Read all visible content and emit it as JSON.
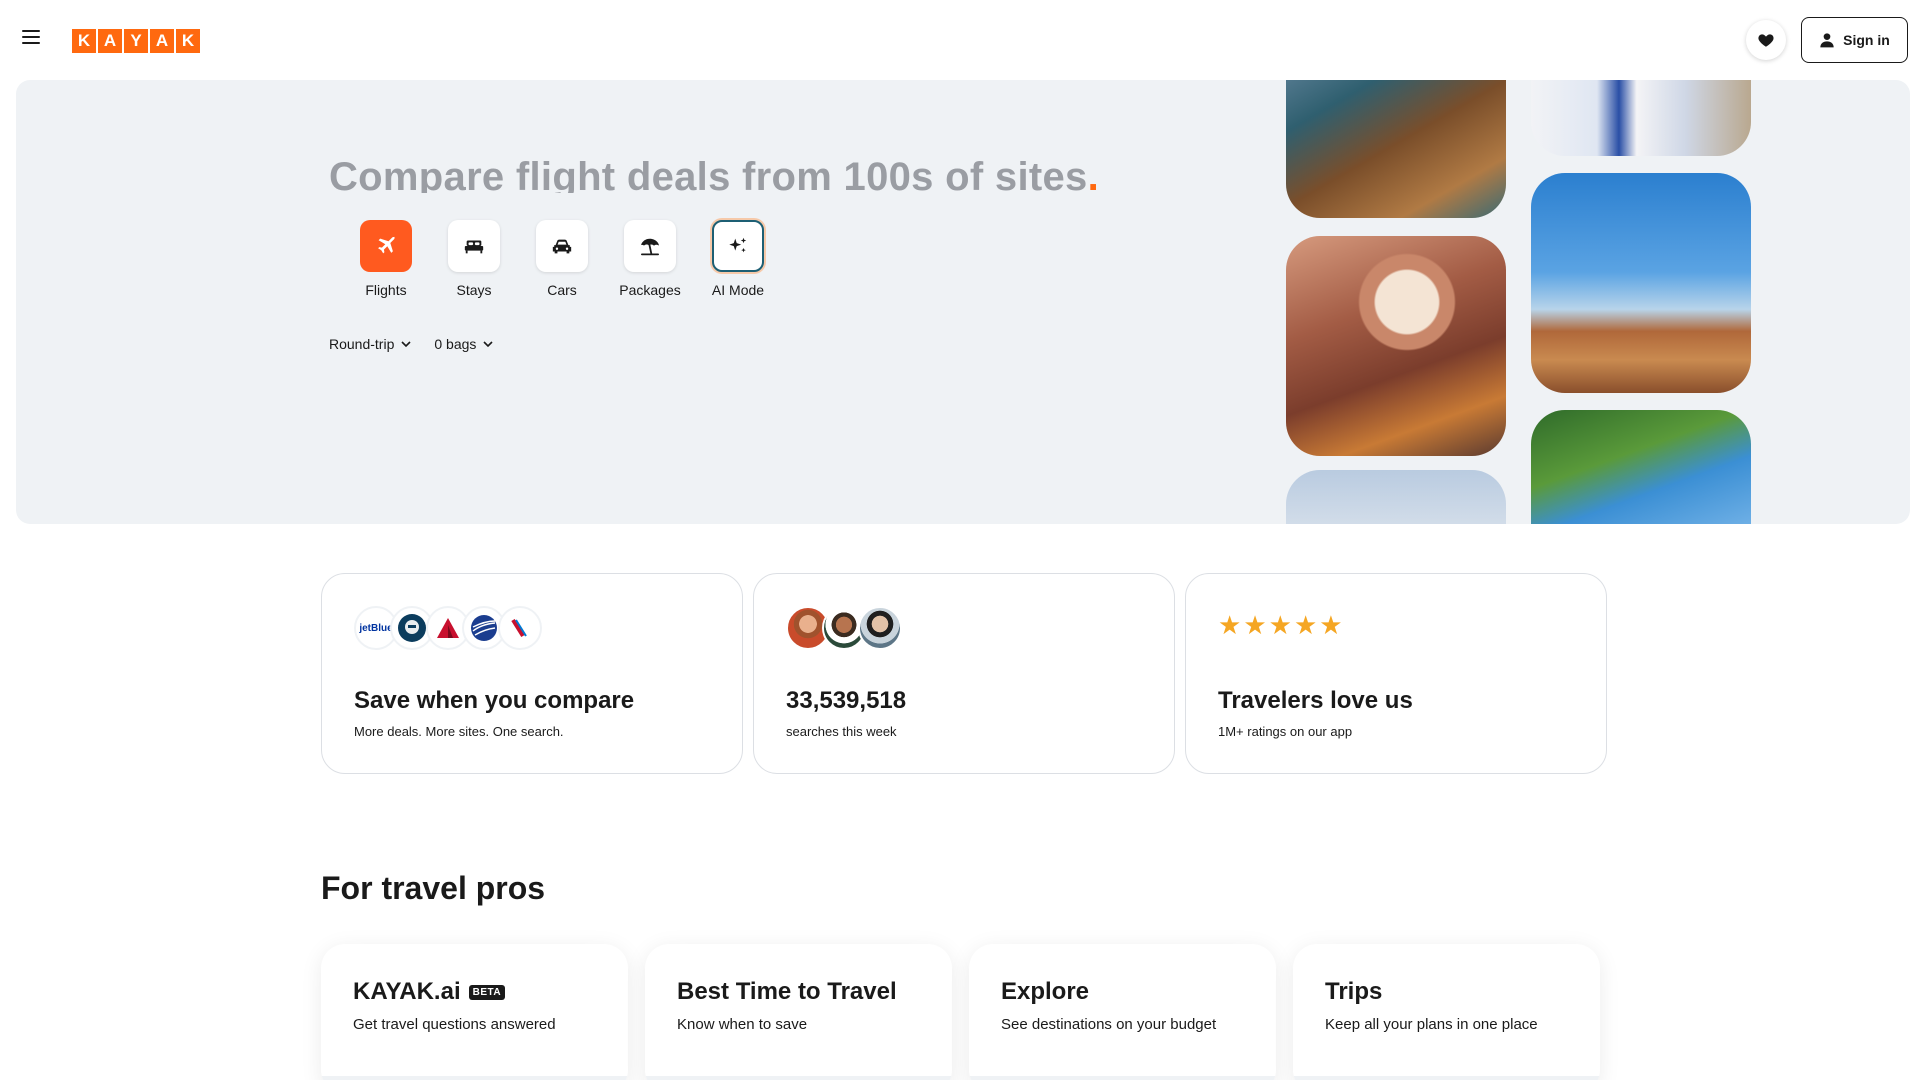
{
  "header": {
    "logo_letters": [
      "K",
      "A",
      "Y",
      "A",
      "K"
    ],
    "signin_label": "Sign in",
    "brand_color": "#ff690f"
  },
  "hero": {
    "title": "Compare flight deals from 100s of sites",
    "title_dot": ".",
    "verticals": [
      {
        "label": "Flights",
        "icon": "plane-icon",
        "active": true
      },
      {
        "label": "Stays",
        "icon": "bed-icon",
        "active": false
      },
      {
        "label": "Cars",
        "icon": "car-icon",
        "active": false
      },
      {
        "label": "Packages",
        "icon": "beach-umbrella-icon",
        "active": false
      },
      {
        "label": "AI Mode",
        "icon": "sparkle-icon",
        "active": false
      }
    ],
    "trip_type": "Round-trip",
    "bags": "0 bags"
  },
  "stats": [
    {
      "title": "Save when you compare",
      "subtitle": "More deals. More sites. One search.",
      "airline_logos": [
        "jetBlue",
        "Alaska",
        "Delta",
        "United",
        "American"
      ]
    },
    {
      "title": "33,539,518",
      "subtitle": "searches this week"
    },
    {
      "title": "Travelers love us",
      "subtitle": "1M+ ratings on our app",
      "rating_stars": 5
    }
  ],
  "travel_pros": {
    "title": "For travel pros",
    "cards": [
      {
        "title": "KAYAK.ai",
        "badge": "BETA",
        "subtitle": "Get travel questions answered"
      },
      {
        "title": "Best Time to Travel",
        "subtitle": "Know when to save"
      },
      {
        "title": "Explore",
        "subtitle": "See destinations on your budget"
      },
      {
        "title": "Trips",
        "subtitle": "Keep all your plans in one place"
      }
    ]
  }
}
